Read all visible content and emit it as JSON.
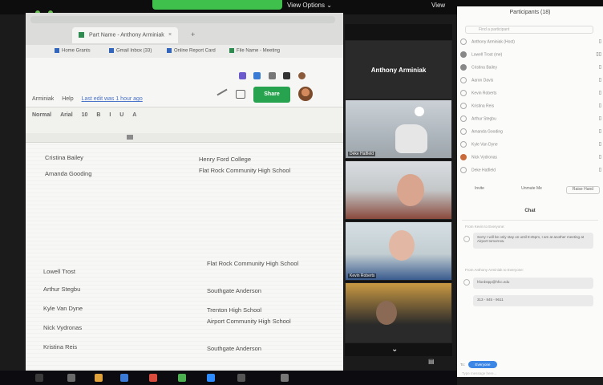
{
  "zoom": {
    "view_options": "View Options ⌄",
    "view": "View"
  },
  "browser": {
    "tab_title": "Part Name - Anthony Arminiak",
    "tab_close": "×",
    "new_tab": "+",
    "bookmarks": [
      "Home Grants",
      "Gmail Inbox (33)",
      "Online Report Card",
      "File Name - Meeting"
    ],
    "menu": {
      "items": [
        "Arminiak",
        "Help"
      ],
      "last_edit": "Last edit was 1 hour ago"
    },
    "toolbar": [
      "Normal",
      "Arial",
      "10",
      "B",
      "I",
      "U",
      "A"
    ],
    "share_label": "Share"
  },
  "table": {
    "rows": [
      {
        "name": "Cristina Bailey",
        "school": "Henry Ford College"
      },
      {
        "name": "Amanda Gooding",
        "school": "Flat Rock Community High School"
      },
      {
        "name": "Lowell Trost",
        "school": "Flat Rock Community High School"
      },
      {
        "name": "Arthur Stegbu",
        "school": "Southgate Anderson"
      },
      {
        "name": "Kyle Van Dyne",
        "school": "Trenton High School"
      },
      {
        "name": "Nick Vydronas",
        "school": "Airport Community High School"
      },
      {
        "name": "Kristina Reis",
        "school": "Southgate Anderson"
      }
    ]
  },
  "gallery": {
    "name_tile": "Anthony Arminiak",
    "tile_labels": [
      "Deke Hatfield",
      "",
      "Kevin Roberts",
      ""
    ],
    "chevron": "⌄"
  },
  "participants": {
    "title": "Participants (18)",
    "search_placeholder": "Find a participant",
    "rows": [
      "Anthony Arminiak (Host)",
      "Lowell Trost (me)",
      "Cristina Bailey",
      "Aaron Davis",
      "Kevin Roberts",
      "Kristina Reis",
      "Arthur Stegbu",
      "Amanda Gooding",
      "Kyle Van Dyne",
      "Nick Vydronas",
      "Deke Hatfield"
    ],
    "buttons": [
      "Invite",
      "Unmute Me",
      "Raise Hand"
    ]
  },
  "chat": {
    "header": "Chat",
    "messages": [
      {
        "meta": "From Kevin to Everyone:",
        "text": "Sorry I will be only stay on until 8:45pm, I am at another meeting at Airport tomorrow."
      },
      {
        "meta": "From Anthony Arminiak to Everyone:",
        "text": "hfordstpp@hfcc.edu"
      },
      {
        "meta": "",
        "text": "313 - 845 - 9611"
      }
    ],
    "to_label": "To:",
    "to_value": "Everyone",
    "type_hint": "Type message here..."
  }
}
